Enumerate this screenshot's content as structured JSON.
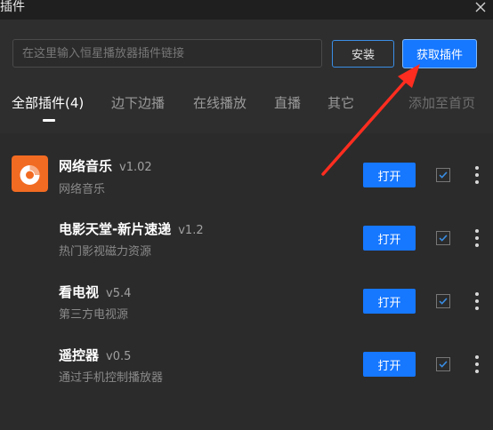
{
  "window": {
    "title": "插件"
  },
  "toolbar": {
    "search_placeholder": "在这里输入恒星播放器插件链接",
    "install_label": "安装",
    "get_plugins_label": "获取插件"
  },
  "tabs": [
    {
      "label": "全部插件(4)",
      "active": true
    },
    {
      "label": "边下边播",
      "active": false
    },
    {
      "label": "在线播放",
      "active": false
    },
    {
      "label": "直播",
      "active": false
    },
    {
      "label": "其它",
      "active": false
    }
  ],
  "add_home_label": "添加至首页",
  "plugins": [
    {
      "name": "网络音乐",
      "version": "v1.02",
      "desc": "网络音乐",
      "open_label": "打开",
      "checked": true,
      "icon": "music-disc-icon",
      "icon_color": "#f26b22"
    },
    {
      "name": "电影天堂-新片速递",
      "version": "v1.2",
      "desc": "热门影视磁力资源",
      "open_label": "打开",
      "checked": true
    },
    {
      "name": "看电视",
      "version": "v5.4",
      "desc": "第三方电视源",
      "open_label": "打开",
      "checked": true
    },
    {
      "name": "遥控器",
      "version": "v0.5",
      "desc": "通过手机控制播放器",
      "open_label": "打开",
      "checked": true
    }
  ],
  "colors": {
    "accent": "#1677ff",
    "annotation_arrow": "#ff2d1f",
    "background": "#2b2b2b"
  }
}
